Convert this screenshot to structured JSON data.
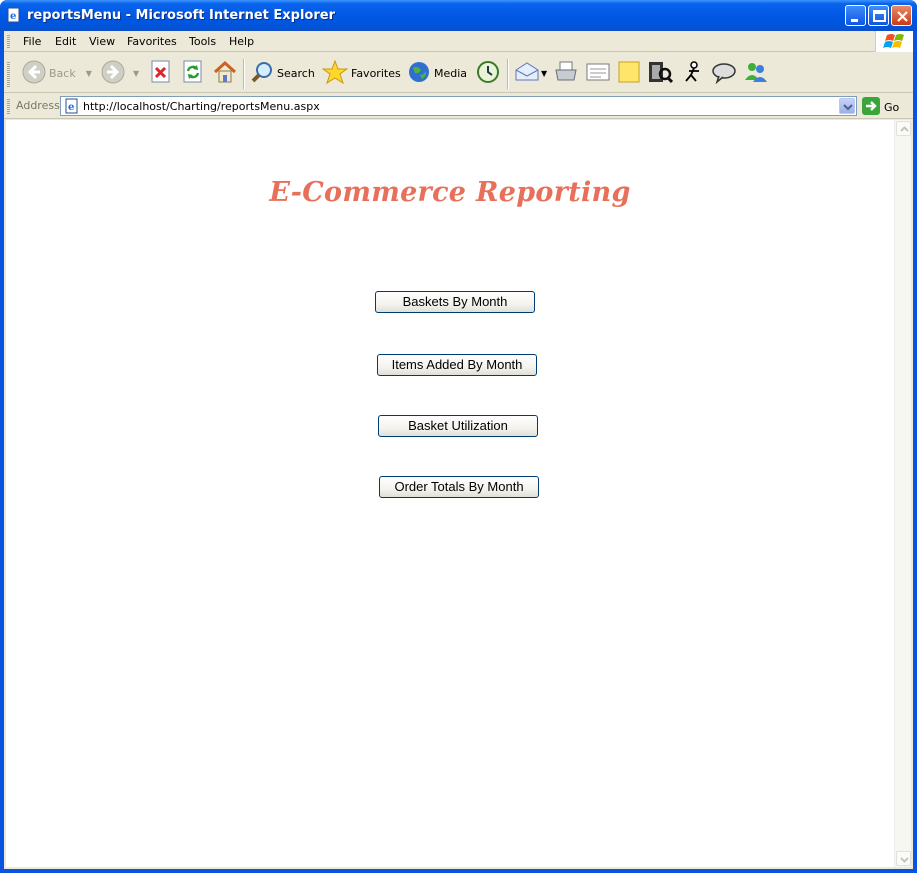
{
  "window": {
    "title": "reportsMenu - Microsoft Internet Explorer"
  },
  "menu": {
    "items": [
      "File",
      "Edit",
      "View",
      "Favorites",
      "Tools",
      "Help"
    ]
  },
  "toolbar": {
    "back_label": "Back",
    "search_label": "Search",
    "favorites_label": "Favorites",
    "media_label": "Media"
  },
  "address": {
    "label": "Address",
    "url": "http://localhost/Charting/reportsMenu.aspx",
    "go_label": "Go"
  },
  "page": {
    "heading": "E-Commerce Reporting",
    "buttons": [
      "Baskets By Month",
      "Items Added By Month",
      "Basket Utilization",
      "Order Totals By Month"
    ]
  },
  "colors": {
    "heading": "#e8705a",
    "titlebar": "#0054e3",
    "button_border": "#003c74"
  }
}
